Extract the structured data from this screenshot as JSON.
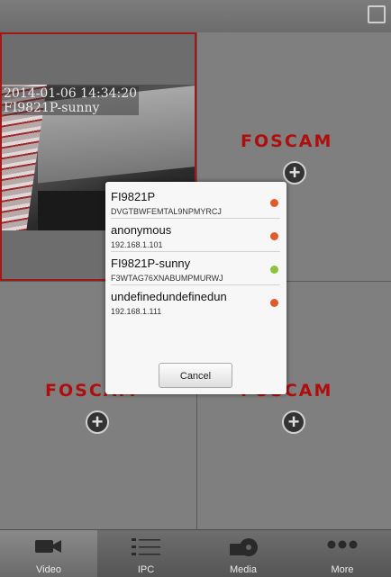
{
  "camera": {
    "timestamp": "2014-01-06 14:34:20",
    "name": "FI9821P-sunny"
  },
  "brand": {
    "logo": "FOSCAM",
    "color": "#b00e0e"
  },
  "dialog": {
    "devices": [
      {
        "name": "FI9821P",
        "detail": "DVGTBWFEMTAL9NPMYRCJ",
        "status": "offline",
        "color": "#e05a2a"
      },
      {
        "name": "anonymous",
        "detail": "192.168.1.101",
        "status": "offline",
        "color": "#e05a2a"
      },
      {
        "name": "FI9821P-sunny",
        "detail": "F3WTAG76XNABUMPMURWJ",
        "status": "online",
        "color": "#8bc43a"
      },
      {
        "name": "undefinedundefinedun",
        "detail": "192.168.1.111",
        "status": "offline",
        "color": "#e05a2a"
      }
    ],
    "cancel_label": "Cancel"
  },
  "nav": {
    "tabs": [
      {
        "label": "Video",
        "icon": "video-camera-icon",
        "active": true
      },
      {
        "label": "IPC",
        "icon": "list-icon",
        "active": false
      },
      {
        "label": "Media",
        "icon": "media-icon",
        "active": false
      },
      {
        "label": "More",
        "icon": "more-icon",
        "active": false
      }
    ]
  }
}
